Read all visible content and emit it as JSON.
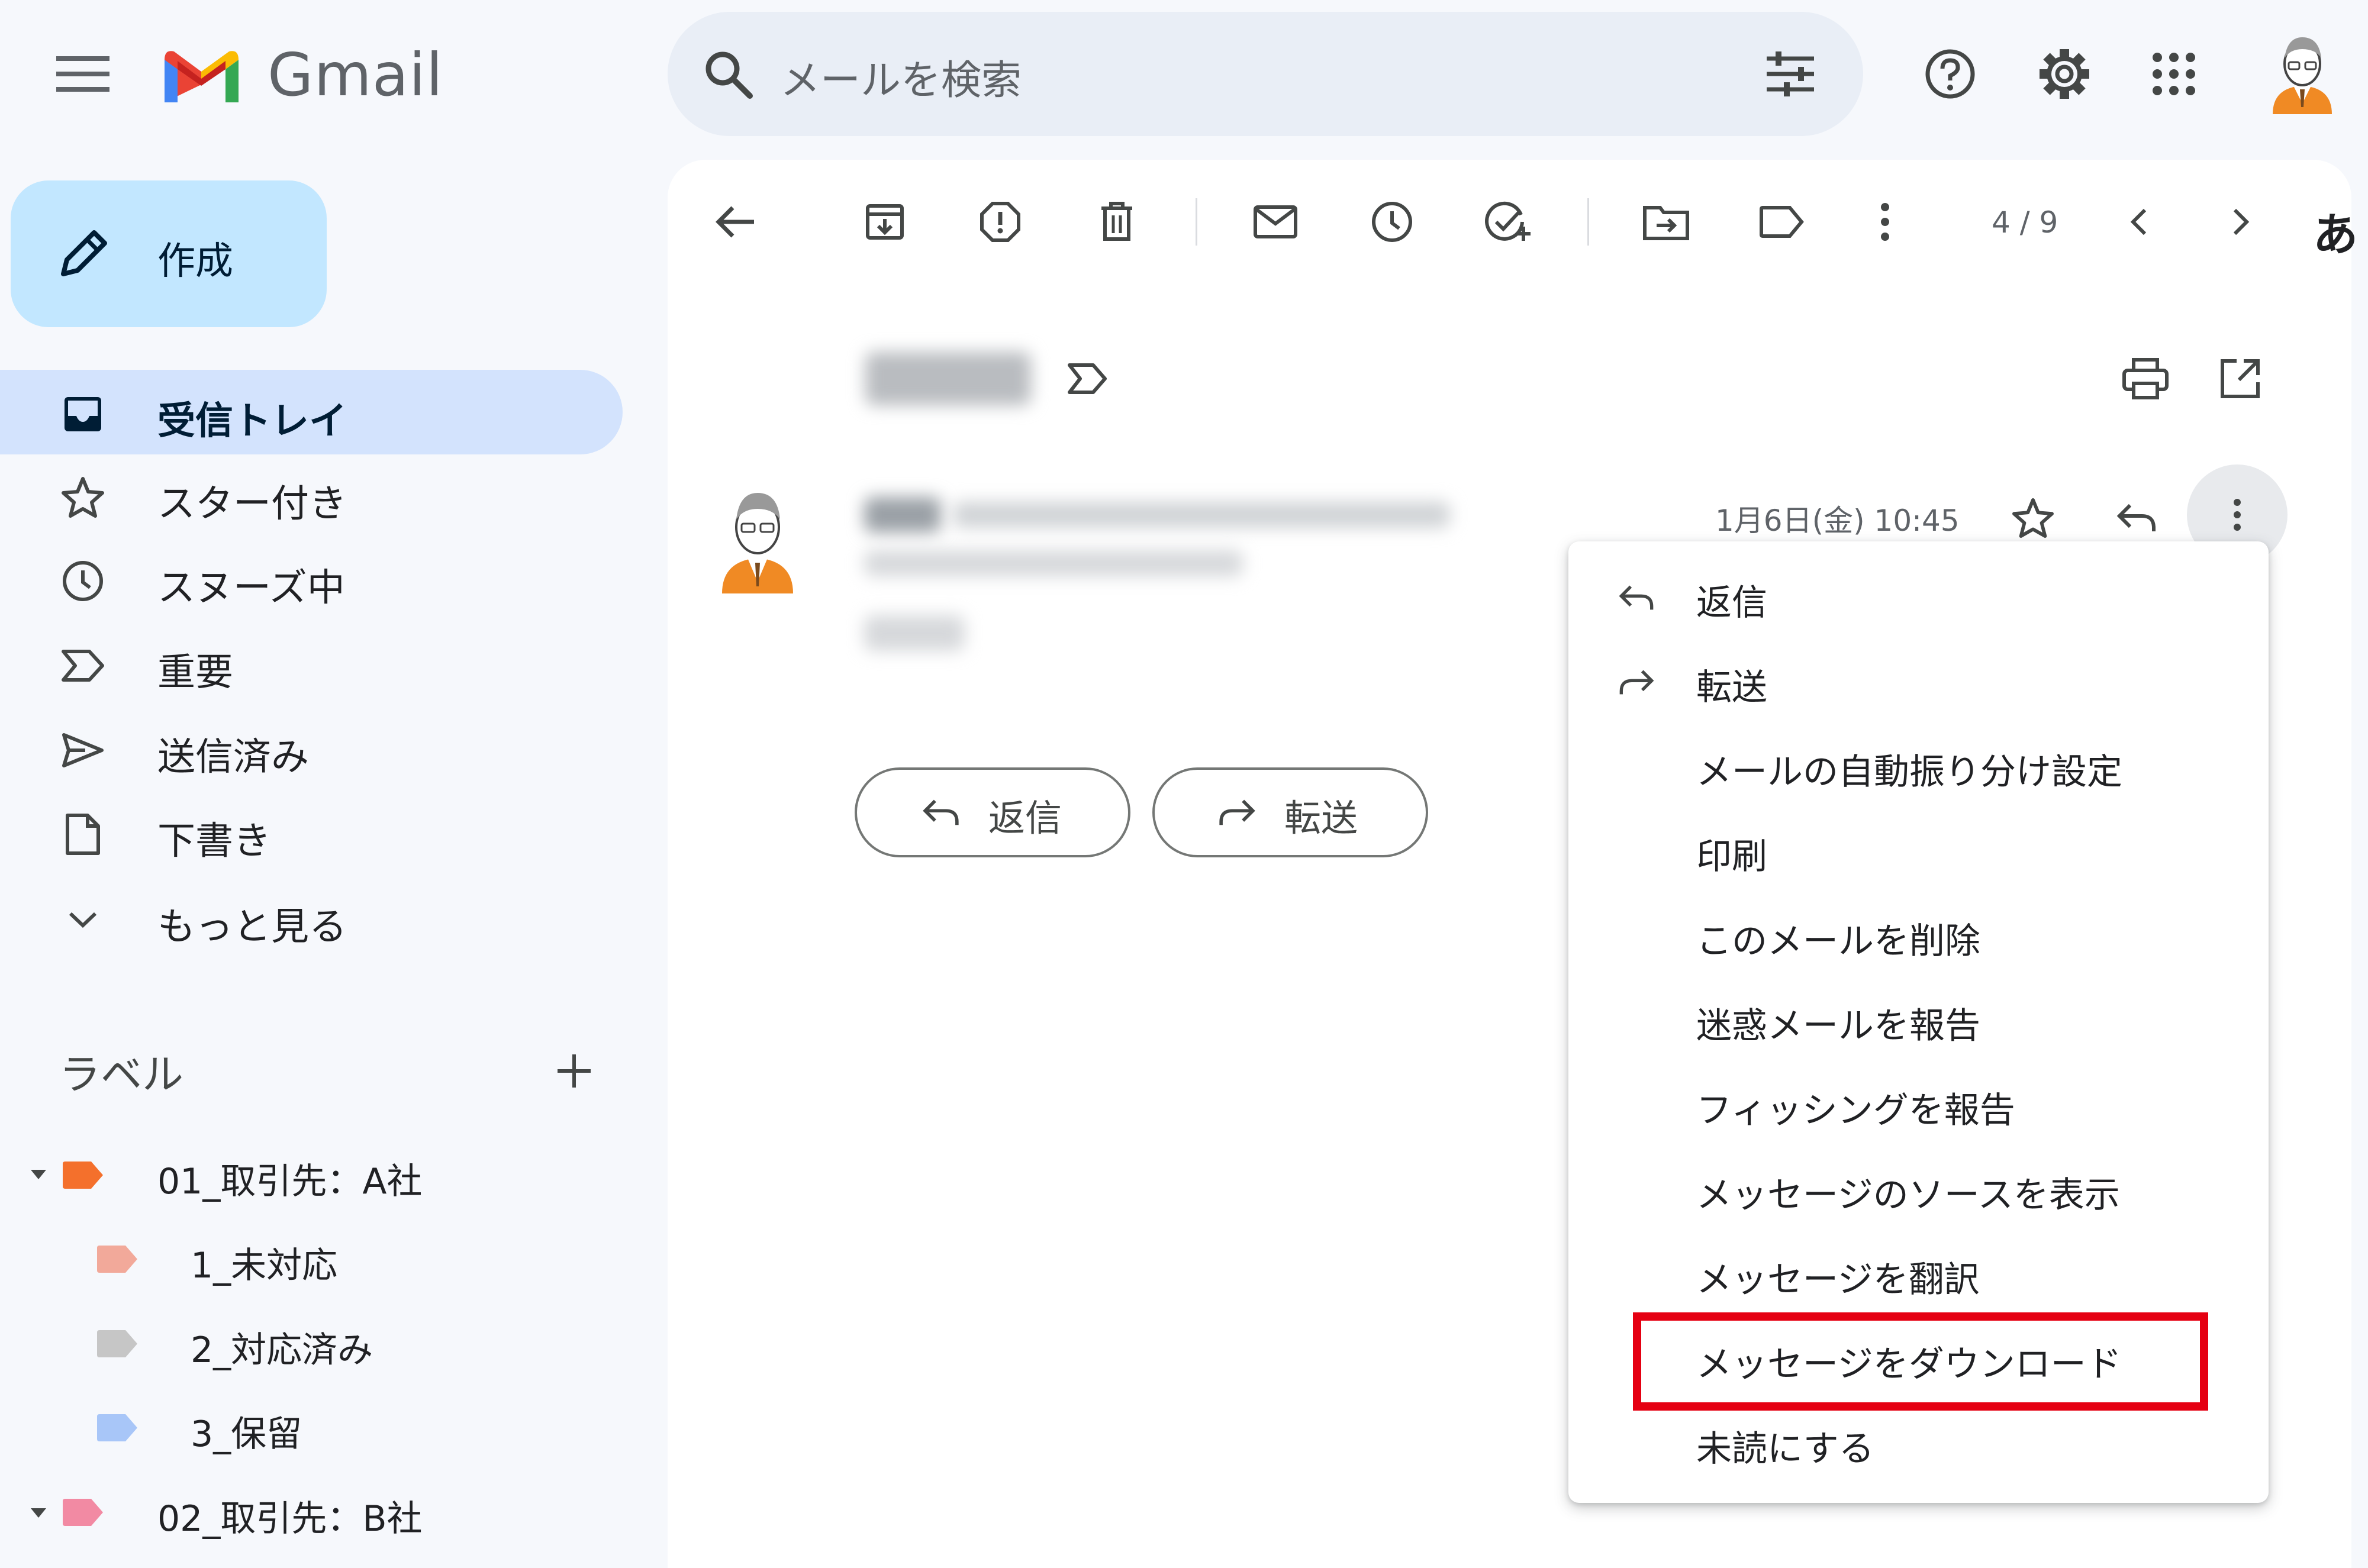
{
  "header": {
    "app_name": "Gmail",
    "search_placeholder": "メールを検索"
  },
  "sidebar": {
    "compose_label": "作成",
    "items": [
      {
        "label": "受信トレイ",
        "icon": "inbox-icon",
        "active": true
      },
      {
        "label": "スター付き",
        "icon": "star-icon"
      },
      {
        "label": "スヌーズ中",
        "icon": "clock-icon"
      },
      {
        "label": "重要",
        "icon": "important-icon"
      },
      {
        "label": "送信済み",
        "icon": "send-icon"
      },
      {
        "label": "下書き",
        "icon": "draft-icon"
      },
      {
        "label": "もっと見る",
        "icon": "chevron-down-icon"
      }
    ],
    "labels_heading": "ラベル",
    "labels": [
      {
        "name": "01_取引先：A社",
        "color": "#f4702c"
      },
      {
        "name": "1_未対応",
        "color": "#f2a99a"
      },
      {
        "name": "2_対応済み",
        "color": "#c6c6c6"
      },
      {
        "name": "3_保留",
        "color": "#a8c6f8"
      },
      {
        "name": "02_取引先：B社",
        "color": "#f28aa3"
      }
    ]
  },
  "toolbar": {
    "page_count": "4 / 9",
    "ime_indicator": "あ"
  },
  "message": {
    "time": "1月6日(金) 10:45",
    "reply_button": "返信",
    "forward_button": "転送"
  },
  "context_menu": {
    "items": [
      {
        "label": "返信",
        "icon": "reply-icon"
      },
      {
        "label": "転送",
        "icon": "forward-icon"
      },
      {
        "label": "メールの自動振り分け設定"
      },
      {
        "label": "印刷"
      },
      {
        "label": "このメールを削除"
      },
      {
        "label": "迷惑メールを報告"
      },
      {
        "label": "フィッシングを報告"
      },
      {
        "label": "メッセージのソースを表示"
      },
      {
        "label": "メッセージを翻訳"
      },
      {
        "label": "メッセージをダウンロード",
        "highlighted": true
      },
      {
        "label": "未読にする"
      }
    ]
  },
  "colors": {
    "highlight": "#e50012",
    "compose": "#c2e7ff",
    "active_nav": "#d3e3fd"
  }
}
